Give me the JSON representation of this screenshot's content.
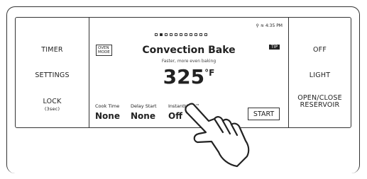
{
  "left_buttons": [
    {
      "label": "TIMER"
    },
    {
      "label": "SETTINGS"
    },
    {
      "label": "LOCK",
      "sublabel": "(3sec)"
    }
  ],
  "right_buttons": [
    {
      "label": "OFF"
    },
    {
      "label": "LIGHT"
    },
    {
      "label": "OPEN/CLOSE\nRESERVOIR"
    }
  ],
  "display": {
    "status": "4:35 PM",
    "mode_tag": "OVEN\nMODE",
    "tip": "TIP",
    "page_indicator": {
      "total": 11,
      "active": 2
    },
    "title": "Convection Bake",
    "subtitle": "Faster, more even baking",
    "temperature": "325",
    "unit": "°F",
    "fields": [
      {
        "label": "Cook Time",
        "value": "None"
      },
      {
        "label": "Delay Start",
        "value": "None"
      },
      {
        "label": "InstantHeat™",
        "value": "Off"
      }
    ],
    "start": "START"
  }
}
